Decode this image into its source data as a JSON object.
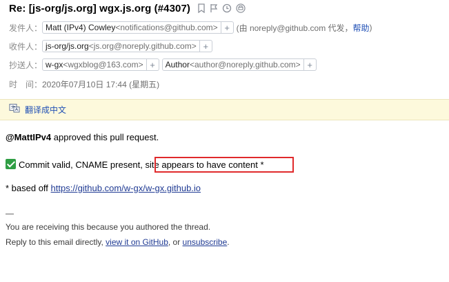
{
  "email": {
    "subject": "Re: [js-org/js.org] wgx.js.org (#4307)",
    "header_icons": [
      "bookmark-icon",
      "flag-icon",
      "clock-icon",
      "print-icon"
    ],
    "from": {
      "label": "发件人：",
      "name": "Matt (IPv4) Cowley",
      "addr": "<notifications@github.com>",
      "plus": "+",
      "via_text": "(由 noreply@github.com 代发，",
      "help": "帮助",
      "close": ")"
    },
    "to": {
      "label": "收件人：",
      "name": "js-org/js.org",
      "addr": "<js.org@noreply.github.com>",
      "plus": "+"
    },
    "cc": {
      "label": "抄送人：",
      "items": [
        {
          "name": "w-gx",
          "addr": "<wgxblog@163.com>",
          "plus": "+"
        },
        {
          "name": "Author",
          "addr": "<author@noreply.github.com>",
          "plus": "+"
        }
      ]
    },
    "time": {
      "label": "时　间：",
      "value": "2020年07月10日 17:44 (星期五)"
    }
  },
  "translate": {
    "icon": "translate-icon",
    "label": "翻译成中文"
  },
  "body": {
    "mention": "@MattIPv4",
    "approved_text": " approved this pull request.",
    "commit_prefix": "Commit valid, CNAME present,",
    "commit_highlight": " site appears to have content *",
    "based_prefix": "* based off ",
    "based_link": "https://github.com/w-gx/w-gx.github.io",
    "separator": "—",
    "receiving": "You are receiving this because you authored the thread.",
    "reply_prefix": "Reply to this email directly, ",
    "reply_link1": "view it on GitHub",
    "reply_mid": ", or ",
    "reply_link2": "unsubscribe",
    "reply_end": "."
  },
  "colors": {
    "link": "#1f3a93",
    "highlight_border": "#e0292b",
    "translate_bg": "#fdf9dc",
    "check_bg": "#2f9e44"
  }
}
